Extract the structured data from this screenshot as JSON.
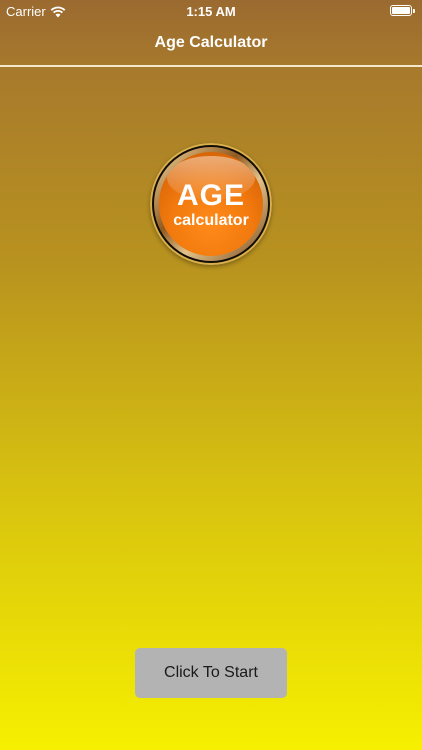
{
  "status_bar": {
    "carrier": "Carrier",
    "time": "1:15 AM",
    "icons": [
      "wifi-icon",
      "battery-icon"
    ]
  },
  "nav": {
    "title": "Age Calculator"
  },
  "logo": {
    "line1": "AGE",
    "line2": "calculator"
  },
  "start_button": {
    "label": "Click To Start"
  },
  "colors": {
    "nav_background": "#9a6a30",
    "gradient_top": "#a77a2c",
    "gradient_bottom": "#f6f000",
    "logo_orange": "#f27a0e",
    "button_gray": "#b3b3b3"
  }
}
